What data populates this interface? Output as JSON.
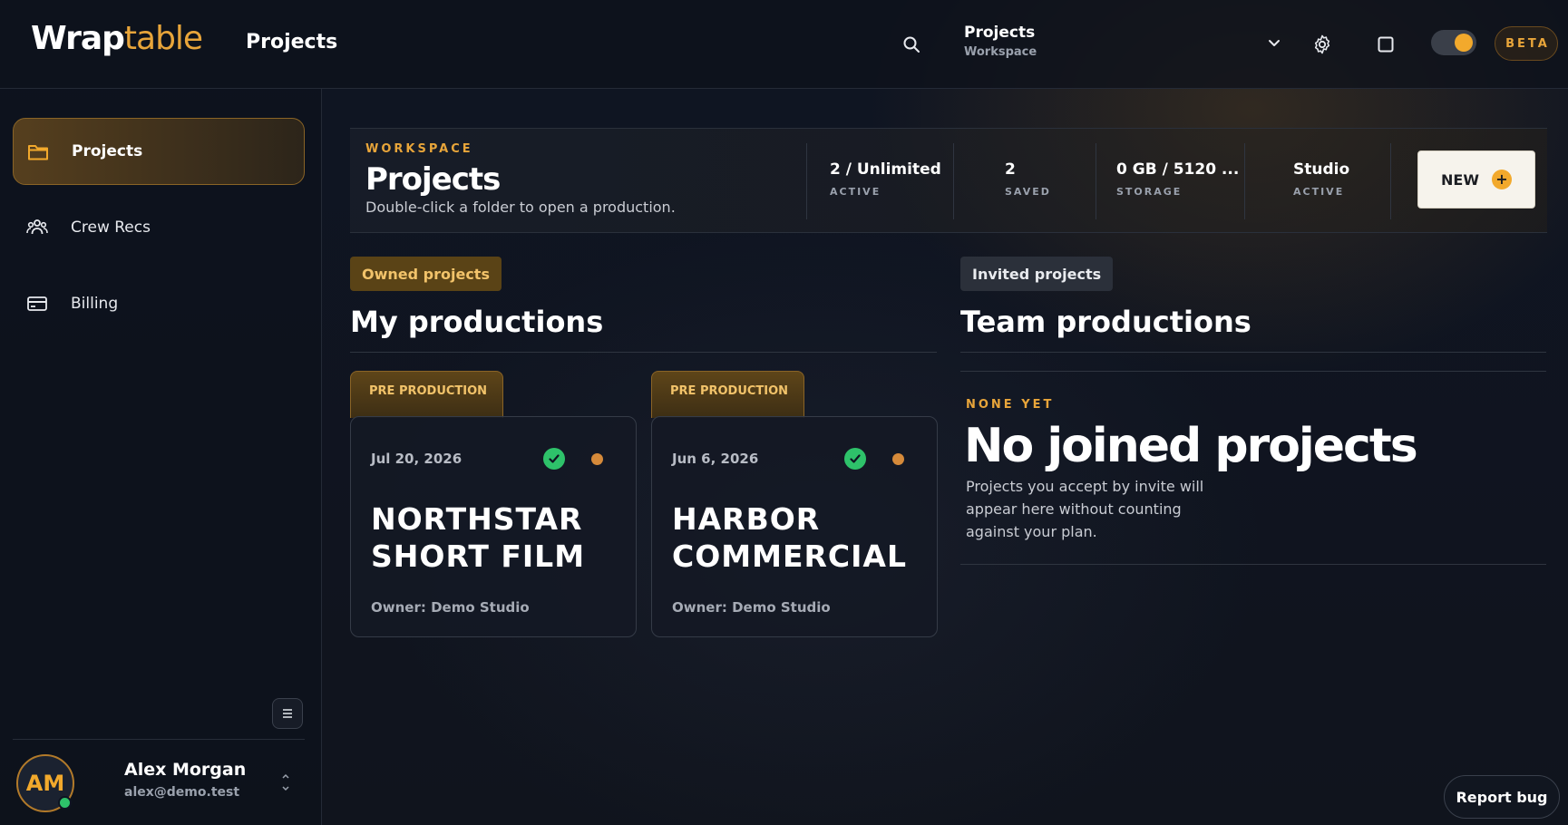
{
  "app": {
    "logo_main": "Wrap",
    "logo_accent": "table",
    "page_title": "Projects"
  },
  "header": {
    "workspace_title": "Projects",
    "workspace_subtitle": "Workspace",
    "beta_label": "BETA",
    "theme_toggle_on": true,
    "icons": [
      "search-icon",
      "chevron-down-icon",
      "gear-icon",
      "square-icon"
    ]
  },
  "sidebar": {
    "items": [
      {
        "label": "Projects",
        "icon": "folder-icon",
        "active": true
      },
      {
        "label": "Crew Recs",
        "icon": "people-icon",
        "active": false
      },
      {
        "label": "Billing",
        "icon": "card-icon",
        "active": false
      }
    ],
    "user": {
      "initials": "AM",
      "name": "Alex Morgan",
      "email": "alex@demo.test",
      "status": "online"
    }
  },
  "workspace": {
    "eyebrow": "WORKSPACE",
    "title": "Projects",
    "subtitle": "Double-click a folder to open a production.",
    "stats": [
      {
        "value": "2 / Unlimited",
        "label": "ACTIVE"
      },
      {
        "value": "2",
        "label": "SAVED"
      },
      {
        "value": "0 GB / 5120 ...",
        "label": "STORAGE"
      },
      {
        "value": "Studio",
        "label": "ACTIVE"
      }
    ],
    "new_button": "NEW",
    "new_button_symbol": "+"
  },
  "owned": {
    "pill": "Owned projects",
    "title": "My productions",
    "cards": [
      {
        "stage": "PRE PRODUCTION",
        "date": "Jul 20, 2026",
        "name": "NORTHSTAR SHORT FILM",
        "owner": "Owner: Demo Studio"
      },
      {
        "stage": "PRE PRODUCTION",
        "date": "Jun 6, 2026",
        "name": "HARBOR COMMERCIAL",
        "owner": "Owner: Demo Studio"
      }
    ]
  },
  "invited": {
    "pill": "Invited projects",
    "title": "Team productions",
    "empty_eyebrow": "NONE YET",
    "empty_title": "No joined projects",
    "empty_text": "Projects you accept by invite will appear here without counting against your plan."
  },
  "footer": {
    "report_bug": "Report bug"
  },
  "colors": {
    "accent": "#e8a53a",
    "success": "#2ec26a",
    "status_dot": "#d68a3a",
    "background": "#0e1422"
  }
}
